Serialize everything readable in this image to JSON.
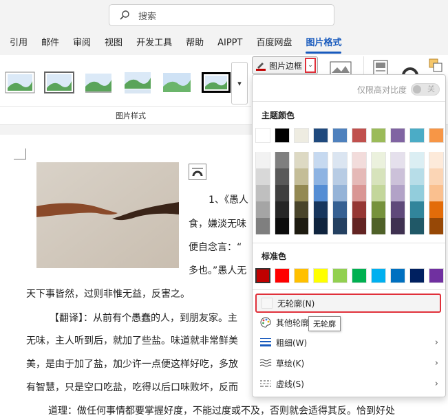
{
  "search": {
    "placeholder": "搜索"
  },
  "tabs": [
    {
      "label": "引用"
    },
    {
      "label": "邮件"
    },
    {
      "label": "审阅"
    },
    {
      "label": "视图"
    },
    {
      "label": "开发工具"
    },
    {
      "label": "帮助"
    },
    {
      "label": "AIPPT"
    },
    {
      "label": "百度网盘"
    },
    {
      "label": "图片格式",
      "active": true
    }
  ],
  "ribbon": {
    "group_label": "图片样式",
    "border_button_label": "图片边框",
    "border_button_icon": "pen-icon",
    "dropdown_icon": "chevron-down-icon",
    "more_icon": "more-styles-icon"
  },
  "menu": {
    "contrast_label": "仅限高对比度",
    "contrast_toggle": "关",
    "theme_colors_title": "主题颜色",
    "theme_colors": [
      "#ffffff",
      "#000000",
      "#eeece1",
      "#1f497d",
      "#4f81bd",
      "#c0504d",
      "#9bbb59",
      "#8064a2",
      "#4bacc6",
      "#f79646"
    ],
    "theme_shades": [
      [
        "#f2f2f2",
        "#d8d8d8",
        "#bfbfbf",
        "#a5a5a5",
        "#7f7f7f"
      ],
      [
        "#7f7f7f",
        "#595959",
        "#3f3f3f",
        "#262626",
        "#0c0c0c"
      ],
      [
        "#ddd9c3",
        "#c4bd97",
        "#938953",
        "#494429",
        "#1d1b10"
      ],
      [
        "#c6d9f0",
        "#8db3e2",
        "#548dd4",
        "#17365d",
        "#0f243e"
      ],
      [
        "#dbe5f1",
        "#b8cce4",
        "#95b3d7",
        "#366092",
        "#244061"
      ],
      [
        "#f2dcdb",
        "#e5b9b7",
        "#d99694",
        "#953734",
        "#632423"
      ],
      [
        "#ebf1dd",
        "#d7e3bc",
        "#c3d69b",
        "#76923c",
        "#4f6128"
      ],
      [
        "#e5e0ec",
        "#ccc1d9",
        "#b2a2c7",
        "#5f497a",
        "#3f3151"
      ],
      [
        "#dbeef3",
        "#b7dde8",
        "#92cddc",
        "#31859b",
        "#205867"
      ],
      [
        "#fdeada",
        "#fbd5b5",
        "#fac08f",
        "#e36c09",
        "#974806"
      ]
    ],
    "standard_colors_title": "标准色",
    "standard_colors": [
      "#c00000",
      "#ff0000",
      "#ffc000",
      "#ffff00",
      "#92d050",
      "#00b050",
      "#00b0f0",
      "#0070c0",
      "#002060",
      "#7030a0"
    ],
    "items": {
      "no_border": "无轮廓(N)",
      "more_colors": "其他轮廓",
      "weight": "粗细(W)",
      "sketched": "草绘(K)",
      "dashes": "虚线(S)"
    },
    "tooltip": "无轮廓"
  },
  "document": {
    "lines": [
      "1、《愚人",
      "食，嫌淡无味",
      "便自念言：“",
      "多也。”愚人无",
      "天下事皆然，过则非惟无益，反害之。",
      "【翻译】：从前有个愚蠢的人，到朋友家。主",
      "无味，主人听到后，就加了些盐。味道就非常鲜美",
      "美，是由于加了盐，加少许一点便这样好吃，多放",
      "有智慧，只是空口吃盐，吃得以后口味败坏，反而",
      "道理：做任何事情都要掌握好度，不能过度或不及，否则就会适得其反。恰到好处"
    ]
  }
}
